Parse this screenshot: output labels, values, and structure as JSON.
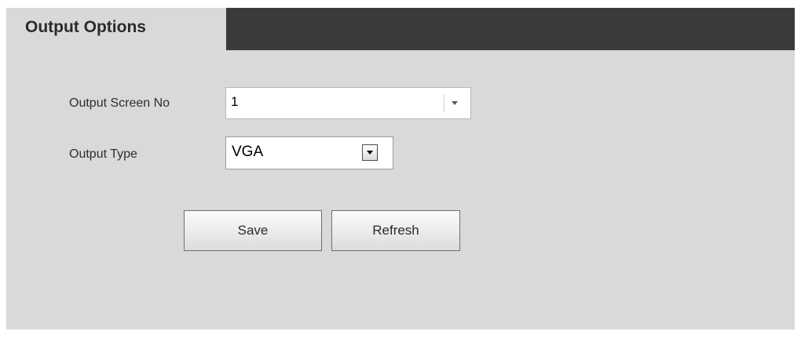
{
  "header": {
    "title": "Output Options"
  },
  "form": {
    "screen_no": {
      "label": "Output Screen No",
      "value": "1"
    },
    "output_type": {
      "label": "Output Type",
      "value": "VGA"
    }
  },
  "actions": {
    "save_label": "Save",
    "refresh_label": "Refresh"
  }
}
